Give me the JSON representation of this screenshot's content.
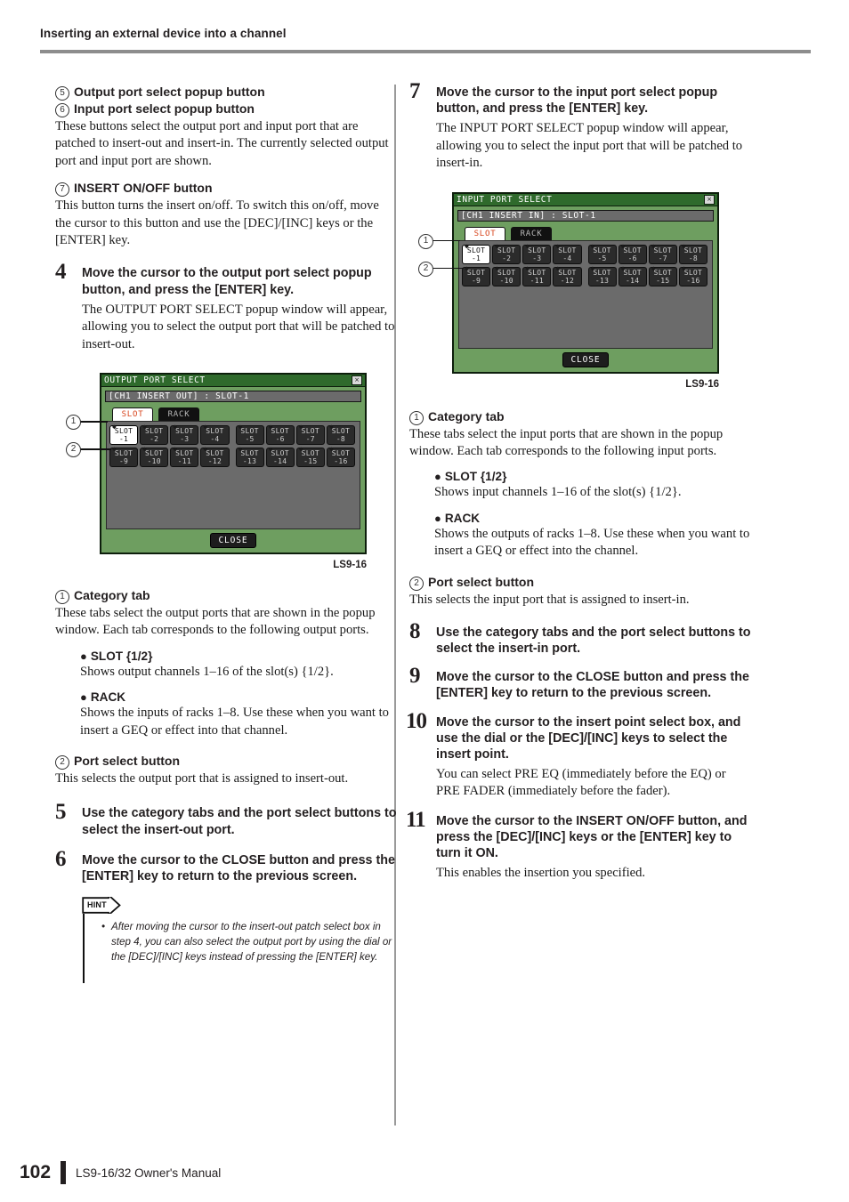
{
  "header": {
    "title": "Inserting an external device into a channel"
  },
  "footer": {
    "page_number": "102",
    "manual": "LS9-16/32  Owner's Manual"
  },
  "left_column": {
    "item5": {
      "marker": "5",
      "title": "Output port select popup button"
    },
    "item6": {
      "marker": "6",
      "title": "Input port select popup button",
      "body": "These buttons select the output port and input port that are patched to insert-out and insert-in. The currently selected output port and input port are shown."
    },
    "item7": {
      "marker": "7",
      "title": "INSERT ON/OFF button",
      "body": "This button turns the insert on/off. To switch this on/off, move the cursor to this button and use the [DEC]/[INC] keys or the [ENTER] key."
    },
    "step4": {
      "number": "4",
      "title": "Move the cursor to the output port select popup button, and press the [ENTER] key.",
      "body": "The OUTPUT PORT SELECT popup window will appear, allowing you to select the output port that will be patched to insert-out."
    },
    "dialog": {
      "title": "OUTPUT PORT SELECT",
      "close_x": "×",
      "path": "[CH1 INSERT OUT] : SLOT-1",
      "tabs": [
        {
          "label": "SLOT",
          "selected": true
        },
        {
          "label": "RACK",
          "selected": false
        }
      ],
      "buttons_row1": [
        "SLOT\n-1",
        "SLOT\n-2",
        "SLOT\n-3",
        "SLOT\n-4",
        "SLOT\n-5",
        "SLOT\n-6",
        "SLOT\n-7",
        "SLOT\n-8"
      ],
      "buttons_row2": [
        "SLOT\n-9",
        "SLOT\n-10",
        "SLOT\n-11",
        "SLOT\n-12",
        "SLOT\n-13",
        "SLOT\n-14",
        "SLOT\n-15",
        "SLOT\n-16"
      ],
      "selected_button": "SLOT-1",
      "close_label": "CLOSE",
      "caption": "LS9-16",
      "callouts": [
        "1",
        "2"
      ]
    },
    "item1": {
      "marker": "1",
      "title": "Category tab",
      "body": "These tabs select the output ports that are shown in the popup window. Each tab corresponds to the following output ports.",
      "bullets": [
        {
          "head": "SLOT {1/2}",
          "body": "Shows output channels 1–16 of the slot(s) {1/2}."
        },
        {
          "head": "RACK",
          "body": "Shows the inputs of racks 1–8. Use these when you want to insert a GEQ or effect into that channel."
        }
      ]
    },
    "item2": {
      "marker": "2",
      "title": "Port select button",
      "body": "This selects the output port that is assigned to insert-out."
    },
    "step5": {
      "number": "5",
      "title": "Use the category tabs and the port select buttons to select the insert-out port."
    },
    "step6": {
      "number": "6",
      "title": "Move the cursor to the CLOSE button and press the [ENTER] key to return to the previous screen."
    },
    "hint": {
      "label": "HINT",
      "items": [
        "After moving the cursor to the insert-out patch select box in step 4, you can also select the output port by using the dial or the [DEC]/[INC] keys instead of pressing the [ENTER] key."
      ]
    }
  },
  "right_column": {
    "step7": {
      "number": "7",
      "title": "Move the cursor to the input port select popup button, and press the [ENTER] key.",
      "body": "The INPUT PORT SELECT popup window will appear, allowing you to select the input port that will be patched to insert-in."
    },
    "dialog": {
      "title": "INPUT PORT SELECT",
      "close_x": "×",
      "path": "[CH1 INSERT IN] : SLOT-1",
      "tabs": [
        {
          "label": "SLOT",
          "selected": true
        },
        {
          "label": "RACK",
          "selected": false
        }
      ],
      "buttons_row1": [
        "SLOT\n-1",
        "SLOT\n-2",
        "SLOT\n-3",
        "SLOT\n-4",
        "SLOT\n-5",
        "SLOT\n-6",
        "SLOT\n-7",
        "SLOT\n-8"
      ],
      "buttons_row2": [
        "SLOT\n-9",
        "SLOT\n-10",
        "SLOT\n-11",
        "SLOT\n-12",
        "SLOT\n-13",
        "SLOT\n-14",
        "SLOT\n-15",
        "SLOT\n-16"
      ],
      "selected_button": "SLOT-1",
      "close_label": "CLOSE",
      "caption": "LS9-16",
      "callouts": [
        "1",
        "2"
      ]
    },
    "item1": {
      "marker": "1",
      "title": "Category tab",
      "body": "These tabs select the input ports that are shown in the popup window. Each tab corresponds to the following input ports.",
      "bullets": [
        {
          "head": "SLOT {1/2}",
          "body": "Shows input channels 1–16 of the slot(s) {1/2}."
        },
        {
          "head": "RACK",
          "body": "Shows the outputs of racks 1–8. Use these when you want to insert a GEQ or effect into the channel."
        }
      ]
    },
    "item2": {
      "marker": "2",
      "title": "Port select button",
      "body": "This selects the input port that is assigned to insert-in."
    },
    "step8": {
      "number": "8",
      "title": "Use the category tabs and the port select buttons to select the insert-in port."
    },
    "step9": {
      "number": "9",
      "title": "Move the cursor to the CLOSE button and press the [ENTER] key to return to the previous screen."
    },
    "step10": {
      "number": "10",
      "title": "Move the cursor to the insert point select box, and use the dial or the [DEC]/[INC] keys to select the insert point.",
      "body": "You can select PRE EQ (immediately before the EQ) or PRE FADER (immediately before the fader)."
    },
    "step11": {
      "number": "11",
      "title": "Move the cursor to the INSERT ON/OFF button, and press the [DEC]/[INC] keys or the [ENTER] key to turn it ON.",
      "body": "This enables the insertion you specified."
    }
  },
  "colors": {
    "lcd_body": "#6e9e60",
    "lcd_titlebar": "#2f6a2c",
    "lcd_panel": "#6b6b6b",
    "tab_selected_text": "#d8451d",
    "rule": "#8d8d8d"
  }
}
